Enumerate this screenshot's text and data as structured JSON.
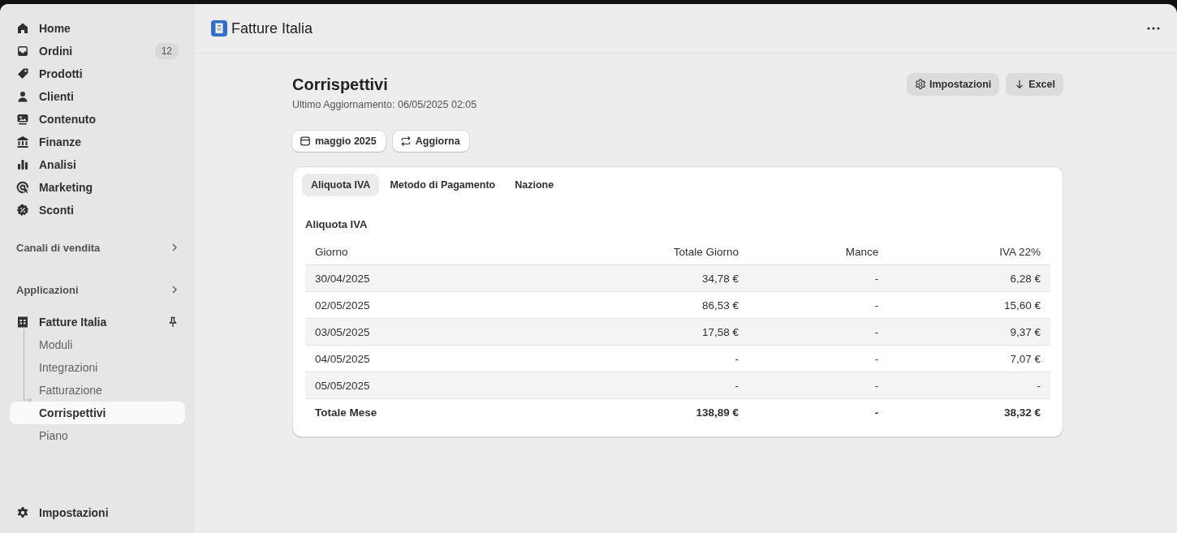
{
  "sidebar": {
    "nav": [
      {
        "label": "Home",
        "selected": false
      },
      {
        "label": "Ordini",
        "badge": "12",
        "selected": false
      },
      {
        "label": "Prodotti",
        "selected": false
      },
      {
        "label": "Clienti",
        "selected": false
      },
      {
        "label": "Contenuto",
        "selected": false
      },
      {
        "label": "Finanze",
        "selected": false
      },
      {
        "label": "Analisi",
        "selected": false
      },
      {
        "label": "Marketing",
        "selected": false
      },
      {
        "label": "Sconti",
        "selected": false
      }
    ],
    "sections": [
      {
        "label": "Canali di vendita"
      },
      {
        "label": "Applicazioni"
      }
    ],
    "app": {
      "label": "Fatture Italia",
      "children": [
        {
          "label": "Moduli",
          "selected": false
        },
        {
          "label": "Integrazioni",
          "selected": false
        },
        {
          "label": "Fatturazione",
          "selected": false
        },
        {
          "label": "Corrispettivi",
          "selected": true
        },
        {
          "label": "Piano",
          "selected": false
        }
      ]
    },
    "footer": {
      "label": "Impostazioni"
    }
  },
  "header": {
    "title": "Fatture Italia"
  },
  "page": {
    "title": "Corrispettivi",
    "subtitle": "Ultimo Aggiornamento: 06/05/2025 02:05",
    "actions": [
      {
        "label": "Impostazioni",
        "kind": "settings"
      },
      {
        "label": "Excel",
        "kind": "download"
      }
    ],
    "filters": [
      {
        "label": "maggio 2025",
        "kind": "calendar"
      },
      {
        "label": "Aggiorna",
        "kind": "refresh"
      }
    ]
  },
  "tabs": [
    {
      "label": "Aliquota IVA",
      "selected": true
    },
    {
      "label": "Metodo di Pagamento",
      "selected": false
    },
    {
      "label": "Nazione",
      "selected": false
    }
  ],
  "table": {
    "title": "Aliquota IVA",
    "columns": [
      "Giorno",
      "Totale Giorno",
      "Mance",
      "IVA 22%"
    ],
    "rows": [
      {
        "kind": "day",
        "cells": [
          "30/04/2025",
          "34,78 €",
          "-",
          "6,28 €"
        ]
      },
      {
        "kind": "day",
        "cells": [
          "02/05/2025",
          "86,53 €",
          "-",
          "15,60 €"
        ]
      },
      {
        "kind": "day",
        "cells": [
          "03/05/2025",
          "17,58 €",
          "-",
          "9,37 €"
        ]
      },
      {
        "kind": "day",
        "cells": [
          "04/05/2025",
          "-",
          "-",
          "7,07 €"
        ]
      },
      {
        "kind": "day",
        "cells": [
          "05/05/2025",
          "-",
          "-",
          "-"
        ]
      },
      {
        "kind": "total",
        "cells": [
          "Totale Mese",
          "138,89 €",
          "-",
          "38,32 €"
        ]
      }
    ]
  }
}
